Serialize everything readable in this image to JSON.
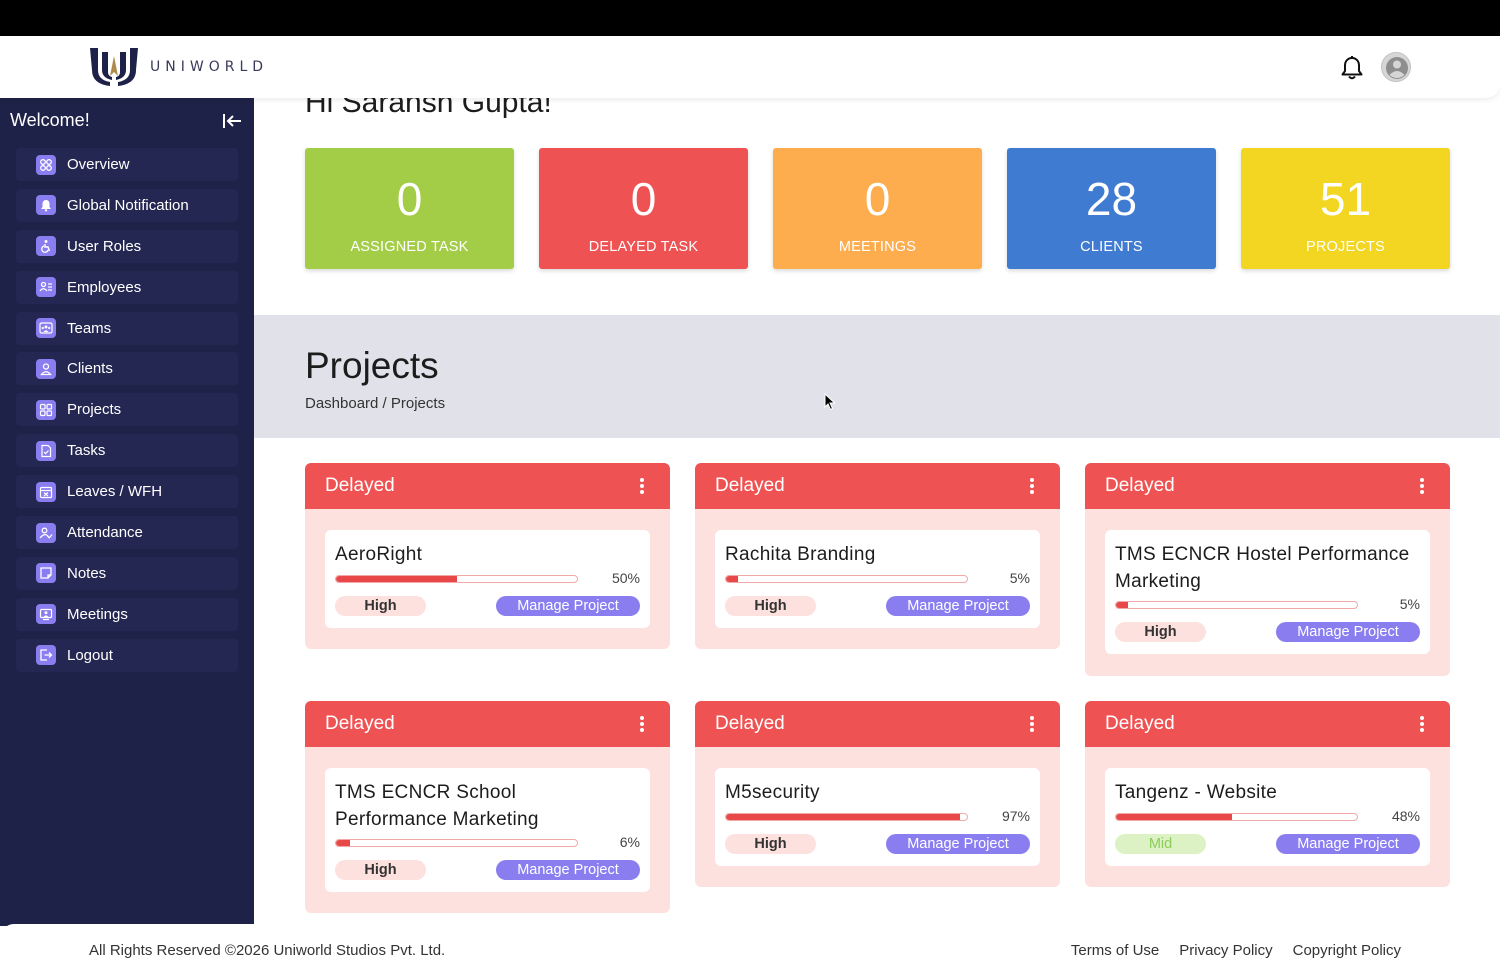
{
  "brand": {
    "name_prefix": "UNI",
    "name_suffix": "WORLD",
    "colors": {
      "navy": "#1f2248",
      "gold": "#b08a4a",
      "accent": "#8a7df0"
    }
  },
  "header": {
    "bell_icon": "bell-icon",
    "avatar_icon": "user-avatar-icon"
  },
  "sidebar": {
    "welcome": "Welcome!",
    "items": [
      {
        "label": "Overview",
        "icon": "overview-icon"
      },
      {
        "label": "Global Notification",
        "icon": "notification-icon"
      },
      {
        "label": "User Roles",
        "icon": "user-roles-icon"
      },
      {
        "label": "Employees",
        "icon": "employees-icon"
      },
      {
        "label": "Teams",
        "icon": "teams-icon"
      },
      {
        "label": "Clients",
        "icon": "clients-icon"
      },
      {
        "label": "Projects",
        "icon": "projects-icon"
      },
      {
        "label": "Tasks",
        "icon": "tasks-icon"
      },
      {
        "label": "Leaves / WFH",
        "icon": "leaves-icon"
      },
      {
        "label": "Attendance",
        "icon": "attendance-icon"
      },
      {
        "label": "Notes",
        "icon": "notes-icon"
      },
      {
        "label": "Meetings",
        "icon": "meetings-icon"
      },
      {
        "label": "Logout",
        "icon": "logout-icon"
      }
    ]
  },
  "main": {
    "greeting": "Hi Saransh Gupta!",
    "stats": [
      {
        "value": "0",
        "label": "ASSIGNED TASK",
        "color": "#a4cd47"
      },
      {
        "value": "0",
        "label": "DELAYED TASK",
        "color": "#ee5252"
      },
      {
        "value": "0",
        "label": "MEETINGS",
        "color": "#fdad4e"
      },
      {
        "value": "28",
        "label": "CLIENTS",
        "color": "#3f7bd1"
      },
      {
        "value": "51",
        "label": "PROJECTS",
        "color": "#f3d622"
      }
    ],
    "projects_section": {
      "title": "Projects",
      "breadcrumb": "Dashboard / Projects"
    },
    "projects": [
      {
        "status": "Delayed",
        "name": "AeroRight",
        "progress": 50,
        "progress_label": "50%",
        "priority": "High",
        "action": "Manage Project"
      },
      {
        "status": "Delayed",
        "name": "Rachita Branding",
        "progress": 5,
        "progress_label": "5%",
        "priority": "High",
        "action": "Manage Project"
      },
      {
        "status": "Delayed",
        "name": "TMS ECNCR Hostel Performance Marketing",
        "progress": 5,
        "progress_label": "5%",
        "priority": "High",
        "action": "Manage Project"
      },
      {
        "status": "Delayed",
        "name": "TMS ECNCR School Performance Marketing",
        "progress": 6,
        "progress_label": "6%",
        "priority": "High",
        "action": "Manage Project"
      },
      {
        "status": "Delayed",
        "name": "M5security",
        "progress": 97,
        "progress_label": "97%",
        "priority": "High",
        "action": "Manage Project"
      },
      {
        "status": "Delayed",
        "name": "Tangenz - Website",
        "progress": 48,
        "progress_label": "48%",
        "priority": "Mid",
        "action": "Manage Project"
      }
    ]
  },
  "footer": {
    "copyright": "All Rights Reserved ©2026 Uniworld Studios Pvt. Ltd.",
    "links": [
      "Terms of Use",
      "Privacy Policy",
      "Copyright Policy"
    ]
  }
}
